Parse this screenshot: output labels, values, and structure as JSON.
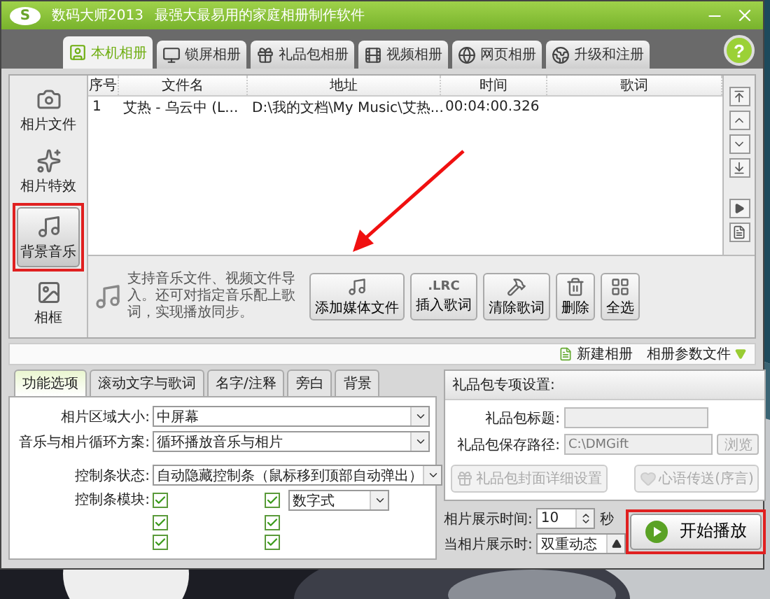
{
  "window": {
    "logo": "S",
    "title": "数码大师2013",
    "subtitle": "最强大最易用的家庭相册制作软件"
  },
  "tabs": [
    {
      "kind": "local",
      "label": "本机相册",
      "selected": true
    },
    {
      "kind": "lock",
      "label": "锁屏相册",
      "selected": false
    },
    {
      "kind": "gift",
      "label": "礼品包相册",
      "selected": false
    },
    {
      "kind": "video",
      "label": "视频相册",
      "selected": false
    },
    {
      "kind": "web",
      "label": "网页相册",
      "selected": false
    },
    {
      "kind": "upgrade",
      "label": "升级和注册",
      "selected": false
    }
  ],
  "help_button": "?",
  "sidebar": {
    "items": [
      {
        "label": "相片文件",
        "selected": false,
        "annotated": false
      },
      {
        "kind": "effect",
        "label": "相片特效",
        "selected": false,
        "annotated": false
      },
      {
        "kind": "music",
        "label": "背景音乐",
        "selected": true,
        "annotated": true
      },
      {
        "kind": "frame",
        "label": "相框",
        "selected": false,
        "annotated": false
      }
    ]
  },
  "table": {
    "columns": [
      "序号",
      "文件名",
      "地址",
      "时间",
      "歌词"
    ],
    "rows": [
      {
        "cells": [
          "1",
          "艾热 - 乌云中 (L...",
          "D:\\我的文档\\My Music\\艾热...",
          "00:04:00.326"
        ]
      }
    ]
  },
  "hint": "支持音乐文件、视频文件导入。还可对指定音乐配上歌词，实现播放同步。",
  "toolbar": [
    {
      "kind": "add",
      "label": "添加媒体文件"
    },
    {
      "kind": "lrc",
      "icon_text": ".LRC",
      "label": "插入歌词"
    },
    {
      "kind": "clear",
      "label": "清除歌词"
    },
    {
      "kind": "delete",
      "label": "删除"
    },
    {
      "kind": "all",
      "label": "全选"
    }
  ],
  "album_bar": {
    "new_album": "新建相册",
    "param_file": "相册参数文件"
  },
  "options": {
    "tabs": [
      {
        "label": "功能选项",
        "selected": true
      },
      {
        "label": "滚动文字与歌词",
        "selected": false
      },
      {
        "label": "名字/注释",
        "selected": false
      },
      {
        "label": "旁白",
        "selected": false
      },
      {
        "label": "背景",
        "selected": false
      }
    ],
    "fields": [
      {
        "label": "相片区域大小:",
        "value": "中屏幕"
      },
      {
        "label": "音乐与相片循环方案:",
        "value": "循环播放音乐与相片"
      },
      {
        "label": "控制条状态:",
        "value": "自动隐藏控制条（鼠标移到顶部自动弹出）"
      }
    ],
    "control_module": {
      "label": "控制条模块:",
      "style": "数字式",
      "checkboxes": [
        {
          "checked": true
        },
        {
          "checked": true
        },
        {
          "checked": true
        },
        {
          "checked": true
        },
        {
          "checked": true
        },
        {
          "checked": true
        }
      ]
    }
  },
  "gift": {
    "title": "礼品包专项设置:",
    "fields": [
      {
        "label": "礼品包标题:",
        "disabled": true
      },
      {
        "label": "礼品包保存路径:",
        "value": "C:\\DMGift",
        "disabled": true,
        "button": "浏览"
      }
    ],
    "buttons": [
      {
        "kind": "cover",
        "label": "礼品包封面详细设置",
        "disabled": true
      },
      {
        "kind": "message",
        "label": "心语传送(序言)",
        "disabled": true
      }
    ]
  },
  "display": {
    "time_label": "相片展示时间:",
    "time_value": "10",
    "time_unit": "秒",
    "mode_label": "当相片展示时:",
    "mode_value": "双重动态"
  },
  "start_button": {
    "label": "开始播放",
    "annotated": true
  }
}
